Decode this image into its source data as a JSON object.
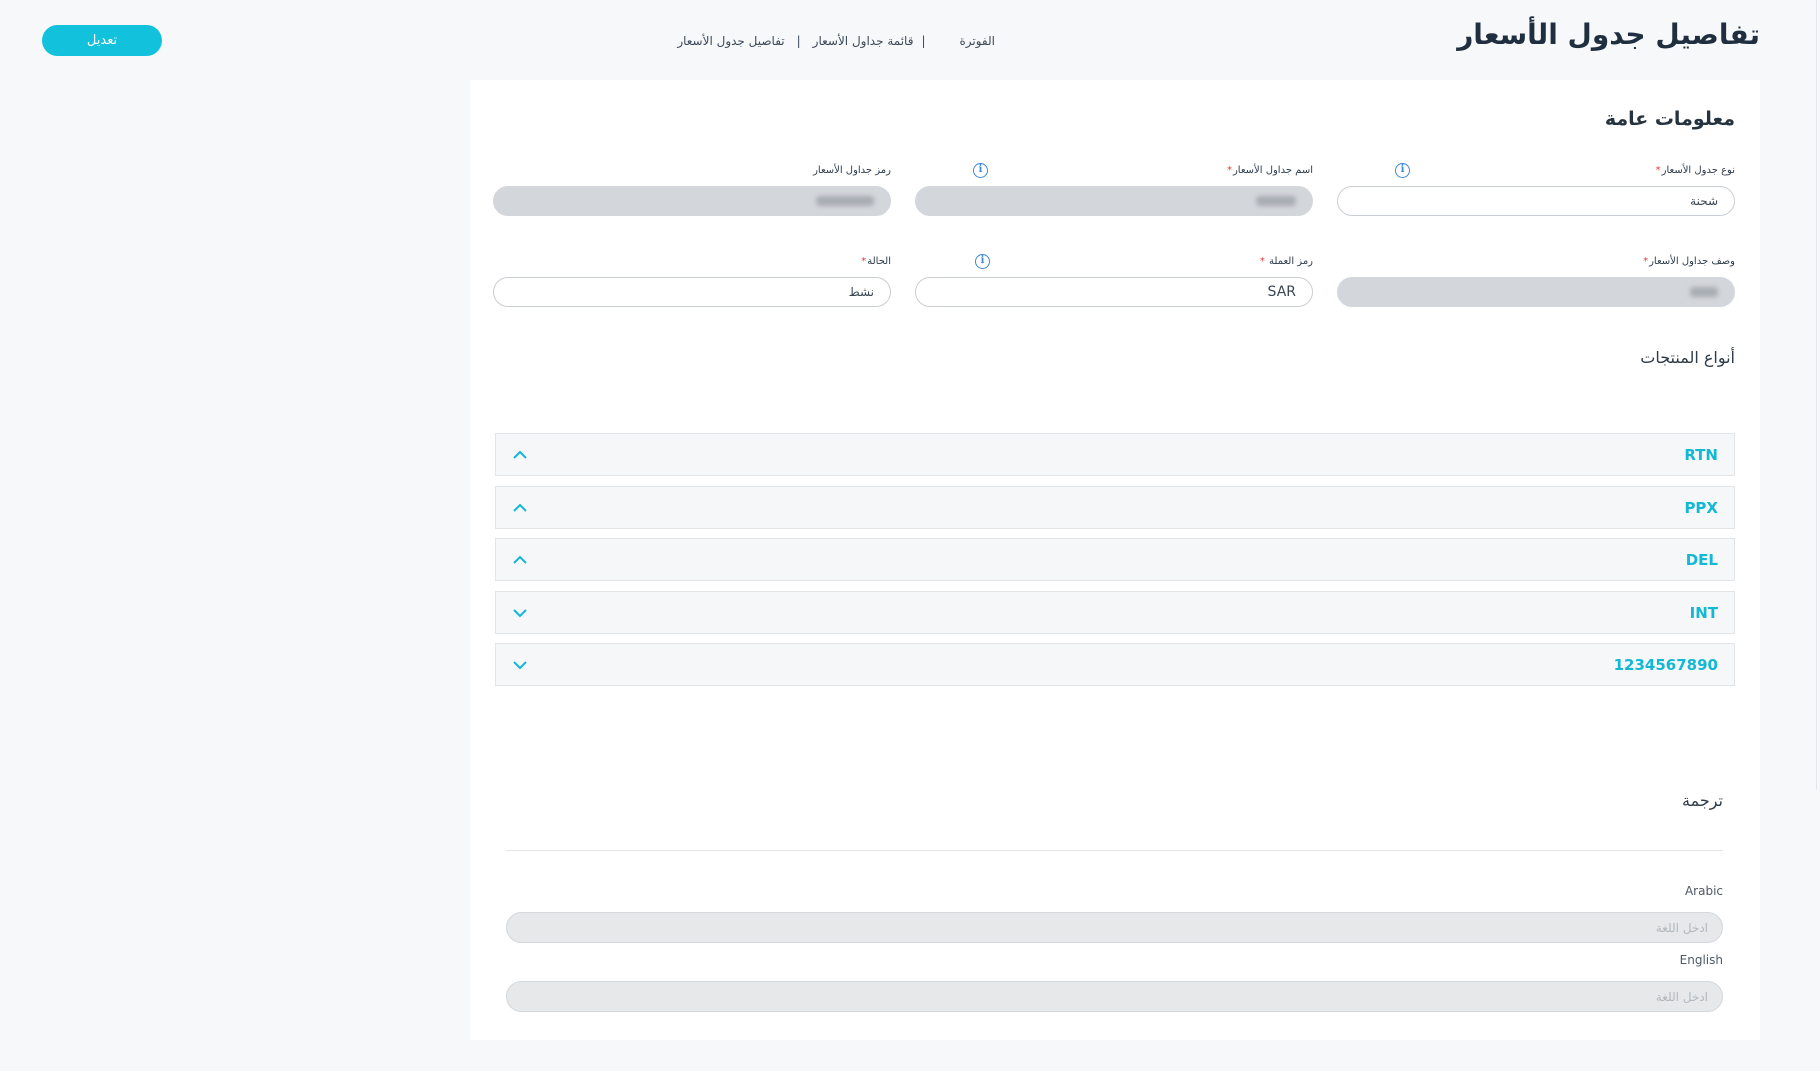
{
  "header": {
    "edit_label": "تعديل",
    "title": "تفاصيل جدول الأسعار",
    "breadcrumb": [
      "الفوترة",
      "قائمة جداول الأسعار",
      "تفاصيل جدول الأسعار"
    ]
  },
  "general": {
    "title": "معلومات عامة",
    "fields": {
      "type": {
        "label": "نوع جدول الأسعار",
        "required": "*",
        "value": "شحنة"
      },
      "name": {
        "label": "اسم جداول الأسعار",
        "required": "*",
        "value": ""
      },
      "code": {
        "label": "رمز جداول الأسعار",
        "value": ""
      },
      "description": {
        "label": "وصف جداول الأسعار",
        "required": "*",
        "value": ""
      },
      "currency": {
        "label": "رمز العملة",
        "required": "*",
        "value": "SAR"
      },
      "status": {
        "label": "الحالة",
        "required": "*",
        "value": "نشط"
      }
    }
  },
  "products": {
    "title": "أنواع المنتجات",
    "items": [
      {
        "code": "RTN",
        "expanded": true
      },
      {
        "code": "PPX",
        "expanded": true
      },
      {
        "code": "DEL",
        "expanded": true
      },
      {
        "code": "INT",
        "expanded": false
      },
      {
        "code": "1234567890",
        "expanded": false
      }
    ]
  },
  "translation": {
    "title": "ترجمة",
    "languages": [
      {
        "label": "Arabic",
        "placeholder": "ادخل اللغة"
      },
      {
        "label": "English",
        "placeholder": "ادخل اللغة"
      }
    ]
  },
  "colors": {
    "accent": "#12c2dc",
    "required": "#e23b3b",
    "info": "#3d87d8"
  }
}
